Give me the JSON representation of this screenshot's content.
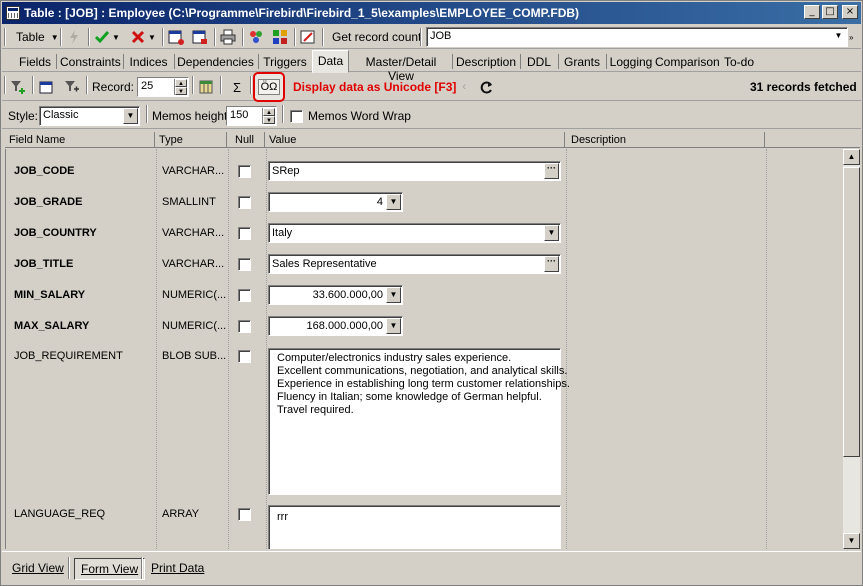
{
  "window": {
    "title": "Table : [JOB] : Employee (C:\\Programme\\Firebird\\Firebird_1_5\\examples\\EMPLOYEE_COMP.FDB)",
    "minimize": "_",
    "maximize": "□",
    "close": "×"
  },
  "toolbar": {
    "table_label": "Table",
    "get_record_count_label": "Get record count",
    "table_combo_value": "JOB"
  },
  "tabs": [
    {
      "label": "Fields"
    },
    {
      "label": "Constraints"
    },
    {
      "label": "Indices"
    },
    {
      "label": "Dependencies"
    },
    {
      "label": "Triggers"
    },
    {
      "label": "Data"
    },
    {
      "label": "Master/Detail View"
    },
    {
      "label": "Description"
    },
    {
      "label": "DDL"
    },
    {
      "label": "Grants"
    },
    {
      "label": "Logging"
    },
    {
      "label": "Comparison"
    },
    {
      "label": "To-do"
    }
  ],
  "data_toolbar": {
    "record_label": "Record:",
    "record_value": "25",
    "sigma": "Σ",
    "unicode_button": "ÖΩ",
    "unicode_hint": "Display data as Unicode [F3]",
    "records_fetched": "31 records fetched",
    "style_label": "Style:",
    "style_value": "Classic",
    "memos_height_label": "Memos height:",
    "memos_height_value": "150",
    "memos_word_wrap_label": "Memos Word Wrap"
  },
  "grid_header": {
    "field_name": "Field Name",
    "type": "Type",
    "null": "Null",
    "value": "Value",
    "description": "Description"
  },
  "fields": [
    {
      "name": "JOB_CODE",
      "type": "VARCHAR...",
      "value": "SRep"
    },
    {
      "name": "JOB_GRADE",
      "type": "SMALLINT",
      "value": "4"
    },
    {
      "name": "JOB_COUNTRY",
      "type": "VARCHAR...",
      "value": "Italy"
    },
    {
      "name": "JOB_TITLE",
      "type": "VARCHAR...",
      "value": "Sales Representative"
    },
    {
      "name": "MIN_SALARY",
      "type": "NUMERIC(...",
      "value": "33.600.000,00"
    },
    {
      "name": "MAX_SALARY",
      "type": "NUMERIC(...",
      "value": "168.000.000,00"
    },
    {
      "name": "JOB_REQUIREMENT",
      "type": "BLOB SUB...",
      "value": "Computer/electronics industry sales experience.\nExcellent communications, negotiation, and analytical skills.\nExperience in establishing long term customer relationships.\nFluency in Italian; some knowledge of German helpful.\nTravel required."
    },
    {
      "name": "LANGUAGE_REQ",
      "type": "ARRAY",
      "value": "rrr"
    }
  ],
  "bottom_tabs": {
    "grid_view": "Grid View",
    "form_view": "Form View",
    "print_data": "Print Data"
  },
  "colors": {
    "titlebar_start": "#0a246a",
    "titlebar_end": "#3a6ea5",
    "highlight_red": "#e00000",
    "panel": "#d4d0c8"
  }
}
